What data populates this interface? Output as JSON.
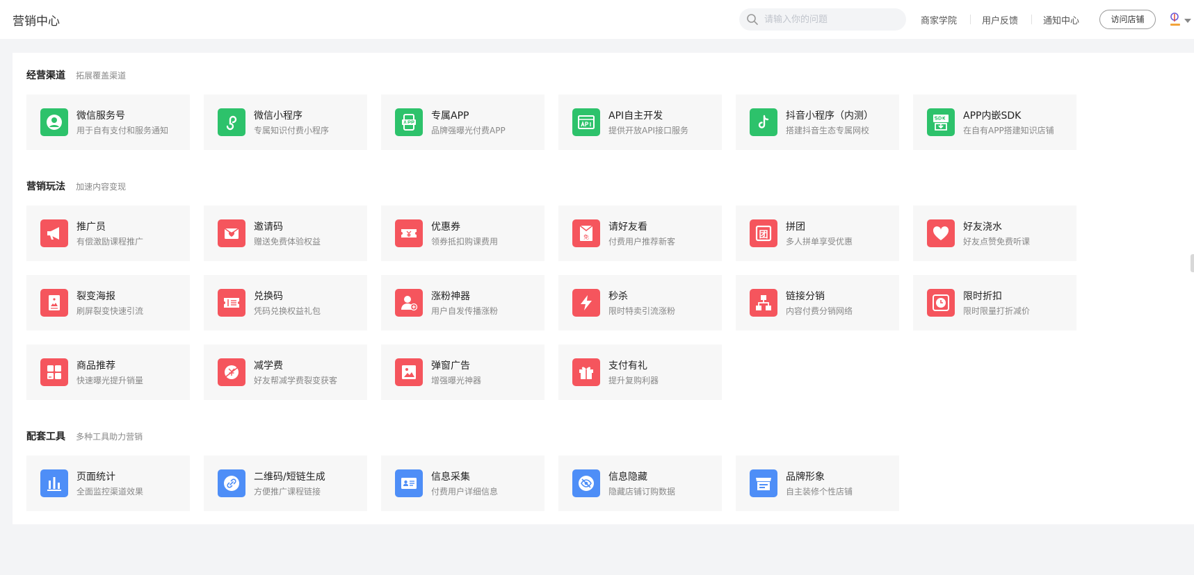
{
  "header": {
    "title": "营销中心",
    "search_placeholder": "请输入你的问题",
    "nav": [
      "商家学院",
      "用户反馈",
      "通知中心"
    ],
    "visit_store": "访问店铺"
  },
  "colors": {
    "green": "#2dc26b",
    "red": "#f5555d",
    "blue": "#4e8ef7"
  },
  "sections": [
    {
      "title": "经营渠道",
      "subtitle": "拓展覆盖渠道",
      "cards": [
        {
          "title": "微信服务号",
          "desc": "用于自有支付和服务通知",
          "icon": "wechat-account-icon"
        },
        {
          "title": "微信小程序",
          "desc": "专属知识付费小程序",
          "icon": "mini-program-icon"
        },
        {
          "title": "专属APP",
          "desc": "品牌强曝光付费APP",
          "icon": "app-icon"
        },
        {
          "title": "API自主开发",
          "desc": "提供开放API接口服务",
          "icon": "api-icon"
        },
        {
          "title": "抖音小程序（内测）",
          "desc": "搭建抖音生态专属网校",
          "icon": "douyin-icon"
        },
        {
          "title": "APP内嵌SDK",
          "desc": "在自有APP搭建知识店铺",
          "icon": "sdk-icon"
        }
      ]
    },
    {
      "title": "营销玩法",
      "subtitle": "加速内容变现",
      "cards": [
        {
          "title": "推广员",
          "desc": "有偿激励课程推广",
          "icon": "megaphone-icon"
        },
        {
          "title": "邀请码",
          "desc": "赠送免费体验权益",
          "icon": "invite-code-icon"
        },
        {
          "title": "优惠券",
          "desc": "领券抵扣购课费用",
          "icon": "coupon-icon"
        },
        {
          "title": "请好友看",
          "desc": "付费用户推荐新客",
          "icon": "free-envelope-icon",
          "glyph": "免"
        },
        {
          "title": "拼团",
          "desc": "多人拼单享受优惠",
          "icon": "group-buy-icon",
          "glyph": "团"
        },
        {
          "title": "好友浇水",
          "desc": "好友点赞免费听课",
          "icon": "heart-icon"
        },
        {
          "title": "裂变海报",
          "desc": "刷屏裂变快速引流",
          "icon": "poster-icon"
        },
        {
          "title": "兑换码",
          "desc": "凭码兑换权益礼包",
          "icon": "redeem-ticket-icon"
        },
        {
          "title": "涨粉神器",
          "desc": "用户自发传播涨粉",
          "icon": "add-user-icon"
        },
        {
          "title": "秒杀",
          "desc": "限时特卖引流涨粉",
          "icon": "lightning-icon"
        },
        {
          "title": "链接分销",
          "desc": "内容付费分销网络",
          "icon": "network-icon"
        },
        {
          "title": "限时折扣",
          "desc": "限时限量打折减价",
          "icon": "clock-icon"
        },
        {
          "title": "商品推荐",
          "desc": "快速曝光提升销量",
          "icon": "product-grid-icon"
        },
        {
          "title": "减学费",
          "desc": "好友帮减学费裂变获客",
          "icon": "discount-slash-icon"
        },
        {
          "title": "弹窗广告",
          "desc": "增强曝光神器",
          "icon": "popup-image-icon"
        },
        {
          "title": "支付有礼",
          "desc": "提升复购利器",
          "icon": "gift-icon"
        }
      ]
    },
    {
      "title": "配套工具",
      "subtitle": "多种工具助力营销",
      "cards": [
        {
          "title": "页面统计",
          "desc": "全面监控渠道效果",
          "icon": "bar-chart-icon"
        },
        {
          "title": "二维码/短链生成",
          "desc": "方便推广课程链接",
          "icon": "link-icon"
        },
        {
          "title": "信息采集",
          "desc": "付费用户详细信息",
          "icon": "id-card-icon"
        },
        {
          "title": "信息隐藏",
          "desc": "隐藏店铺订购数据",
          "icon": "eye-hidden-icon"
        },
        {
          "title": "品牌形象",
          "desc": "自主装修个性店铺",
          "icon": "storefront-icon"
        }
      ]
    }
  ]
}
